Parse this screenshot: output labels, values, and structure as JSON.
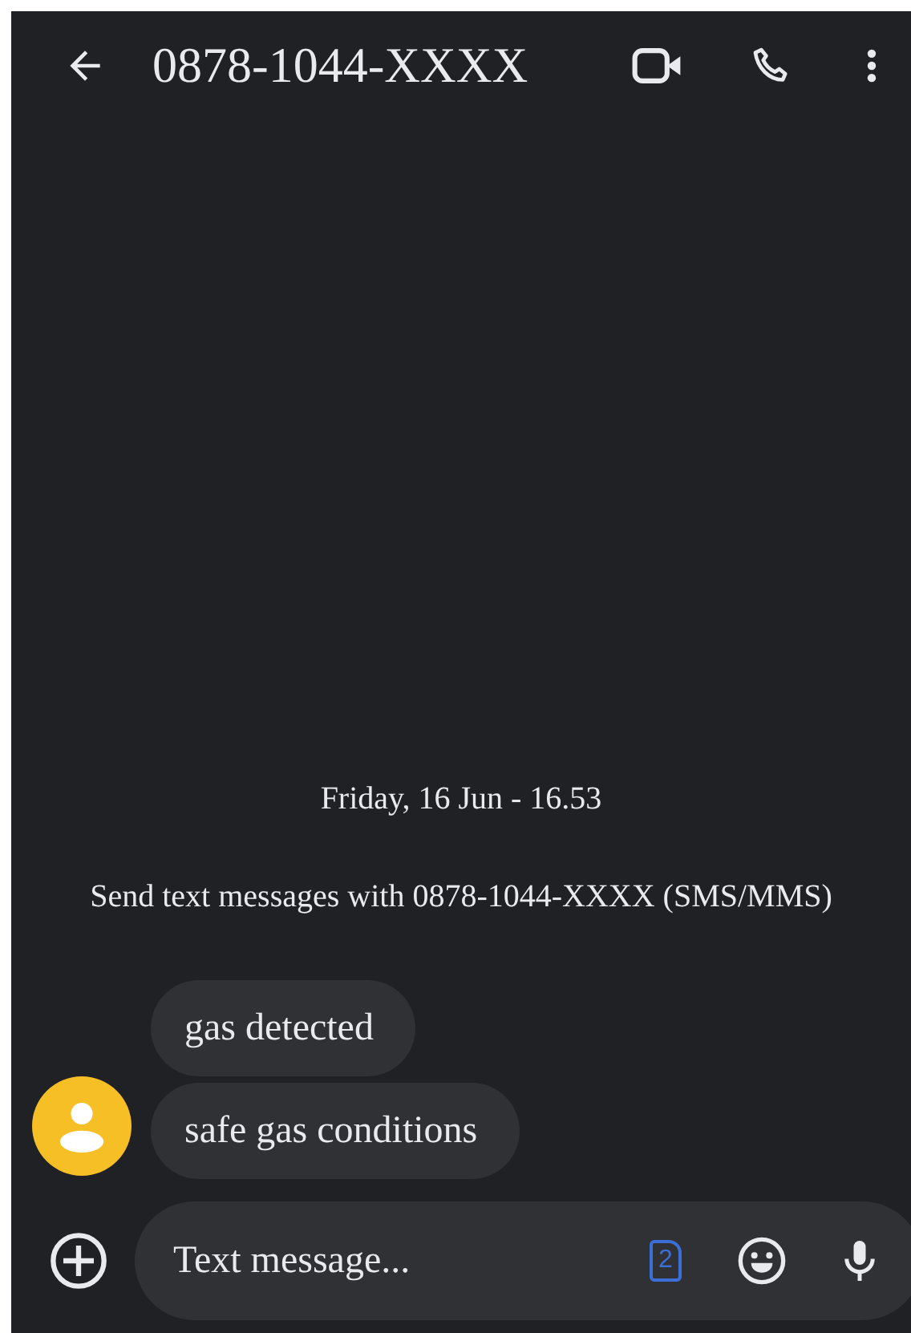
{
  "header": {
    "title": "0878-1044-XXXX"
  },
  "conversation": {
    "date": "Friday, 16 Jun - 16.53",
    "info": "Send text messages with 0878-1044-XXXX (SMS/MMS)",
    "messages": [
      {
        "text": "gas detected"
      },
      {
        "text": "safe gas conditions"
      }
    ]
  },
  "composer": {
    "placeholder": "Text message...",
    "sim_label": "2"
  }
}
